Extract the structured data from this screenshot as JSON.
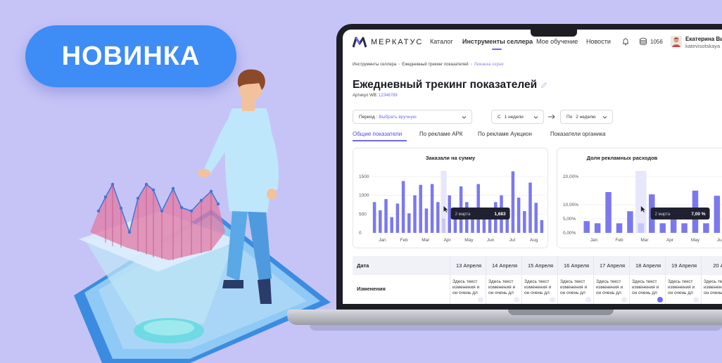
{
  "badge": {
    "label": "НОВИНКА"
  },
  "nav": {
    "logo": "МЕРКАТУС",
    "items": [
      "Каталог",
      "Инструменты селлера",
      "Мое обучение",
      "Новости"
    ],
    "active": "Инструменты селлера",
    "coins": "1056",
    "user_name": "Екатерина Вы",
    "user_login": "katevisotskaya"
  },
  "breadcrumbs": [
    "Инструменты селлера",
    "Ежедневный трекинг показателей",
    "Лежанка серая"
  ],
  "page": {
    "title": "Ежедневный трекинг показателей",
    "article_label": "Артикул WB:",
    "article_value": "12346789"
  },
  "filters": {
    "period_label": "Период :",
    "period_value": "Выбрать вручную",
    "from_label": "С",
    "from_value": "1 недели",
    "to_label": "По",
    "to_value": "2 неделю"
  },
  "tabs": [
    "Общие показатели",
    "По рекламе АРК",
    "По рекламе Аукцион",
    "Показатели органика"
  ],
  "chart_data": [
    {
      "type": "bar",
      "title": "Заказали на сумму",
      "ylim": [
        0,
        1500
      ],
      "yticks": [
        "0",
        "500",
        "1000",
        "1500"
      ],
      "xticks": [
        "Jan",
        "Feb",
        "Mar",
        "Apr",
        "May",
        "Jun",
        "Jul",
        "Aug"
      ],
      "values": [
        820,
        600,
        900,
        420,
        780,
        1380,
        520,
        1000,
        1280,
        650,
        1300,
        820,
        380,
        1000,
        600,
        1240,
        820,
        540,
        1300,
        580,
        400,
        820,
        1000,
        540,
        1640,
        940,
        580,
        1340,
        800,
        340
      ],
      "highlight_index": 12,
      "tooltip": {
        "label": "2 марта",
        "value": "1,683"
      }
    },
    {
      "type": "bar",
      "title": "Доля рекламных расходов",
      "ylim": [
        0,
        20
      ],
      "yticks": [
        "0,00%",
        "5,00%",
        "10,00%",
        "20,00%"
      ],
      "xticks": [
        "Jan",
        "Feb",
        "Mar",
        "Apr",
        "May",
        "Jun"
      ],
      "values": [
        4.2,
        3.4,
        14.5,
        3.4,
        7.7,
        3.4,
        13.7,
        3.4,
        5.1,
        3.4,
        15.0,
        3.4,
        13.2,
        1.7
      ],
      "highlight_index": 5,
      "tooltip": {
        "label": "2 марта",
        "value": "7,00 %"
      }
    }
  ],
  "table": {
    "header_label": "Дата",
    "row_label": "Изменения",
    "columns": [
      "13 Апреля",
      "14 Апреля",
      "15 Апреля",
      "16 Апреля",
      "17 Апреля",
      "18 Апреля",
      "19 Апреля",
      "20 Ап"
    ],
    "cell_text": "Здесь текст изменения и он очень дл"
  },
  "colors": {
    "accent": "#6d6bf0",
    "badge": "#3e8cf5",
    "background": "#c6c4f7"
  }
}
